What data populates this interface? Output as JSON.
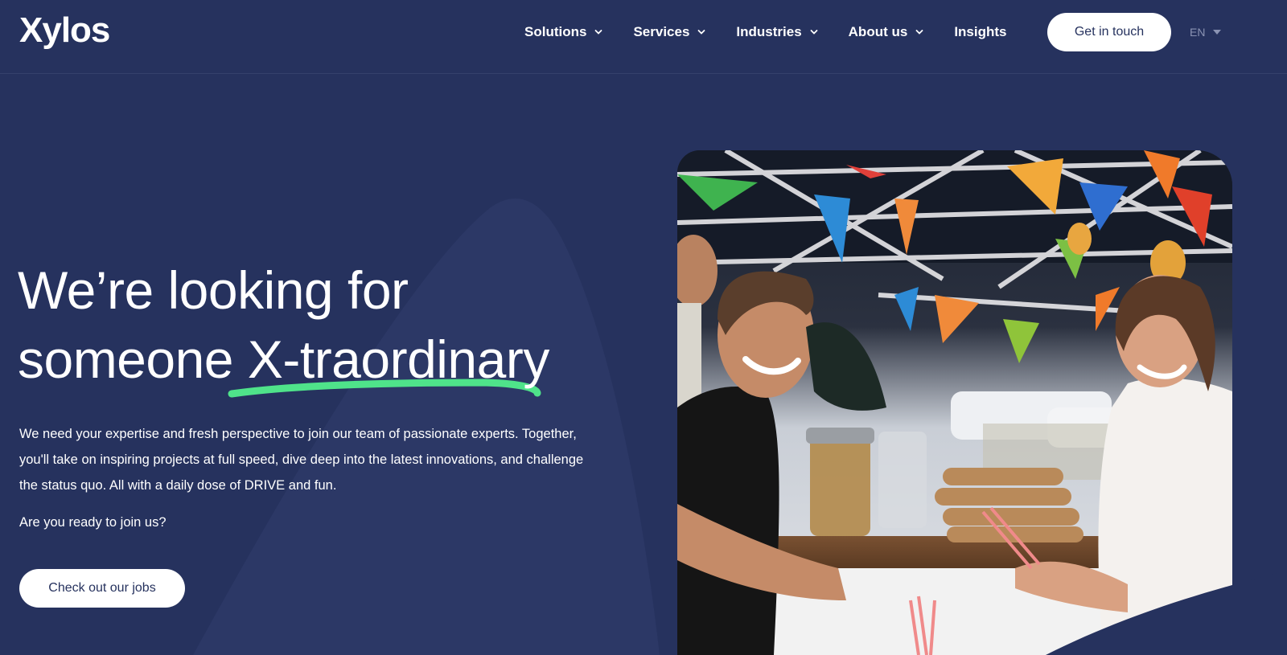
{
  "header": {
    "logo": "Xylos",
    "nav": [
      {
        "label": "Solutions",
        "has_dropdown": true
      },
      {
        "label": "Services",
        "has_dropdown": true
      },
      {
        "label": "Industries",
        "has_dropdown": true
      },
      {
        "label": "About us",
        "has_dropdown": true
      },
      {
        "label": "Insights",
        "has_dropdown": false
      }
    ],
    "cta_label": "Get in touch",
    "language": "EN"
  },
  "hero": {
    "title_line1": "We’re looking for",
    "title_line2_plain": "someone ",
    "title_line2_highlight": "X-traordinary",
    "description": "We need your expertise and fresh perspective to join our team of passionate experts. Together, you'll take on inspiring projects at full speed, dive deep into the latest innovations, and challenge the status quo. All with a daily dose of DRIVE and fun.",
    "question": "Are you ready to join us?",
    "button_label": "Check out our jobs"
  },
  "colors": {
    "background": "#26325e",
    "accent_green": "#4fe38a",
    "button_bg": "#ffffff",
    "button_text": "#26325e"
  }
}
